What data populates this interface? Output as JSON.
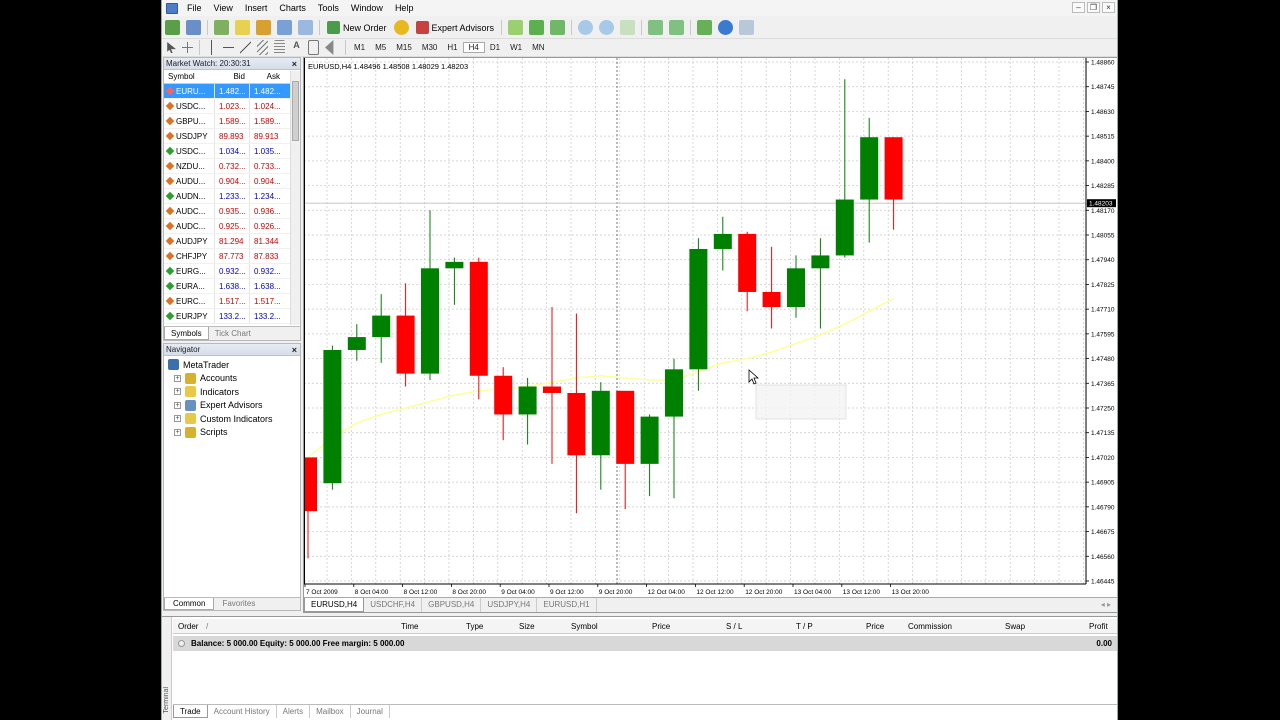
{
  "menu": [
    "File",
    "View",
    "Insert",
    "Charts",
    "Tools",
    "Window",
    "Help"
  ],
  "toolbar": {
    "new_order": "New Order",
    "expert_advisors": "Expert Advisors"
  },
  "periods": [
    "M1",
    "M5",
    "M15",
    "M30",
    "H1",
    "H4",
    "D1",
    "W1",
    "MN"
  ],
  "active_period": "H4",
  "market_watch": {
    "title": "Market Watch: 20:30:31",
    "headers": {
      "symbol": "Symbol",
      "bid": "Bid",
      "ask": "Ask"
    },
    "rows": [
      {
        "symbol": "EURU...",
        "bid": "1.482...",
        "ask": "1.482...",
        "dir": "up",
        "selected": true
      },
      {
        "symbol": "USDC...",
        "bid": "1.023...",
        "ask": "1.024...",
        "dir": "down"
      },
      {
        "symbol": "GBPU...",
        "bid": "1.589...",
        "ask": "1.589...",
        "dir": "down"
      },
      {
        "symbol": "USDJPY",
        "bid": "89.893",
        "ask": "89.913",
        "dir": "down"
      },
      {
        "symbol": "USDC...",
        "bid": "1.034...",
        "ask": "1.035...",
        "dir": "up"
      },
      {
        "symbol": "NZDU...",
        "bid": "0.732...",
        "ask": "0.733...",
        "dir": "down"
      },
      {
        "symbol": "AUDU...",
        "bid": "0.904...",
        "ask": "0.904...",
        "dir": "down"
      },
      {
        "symbol": "AUDN...",
        "bid": "1.233...",
        "ask": "1.234...",
        "dir": "up"
      },
      {
        "symbol": "AUDC...",
        "bid": "0.935...",
        "ask": "0.936...",
        "dir": "down"
      },
      {
        "symbol": "AUDC...",
        "bid": "0.925...",
        "ask": "0.926...",
        "dir": "down"
      },
      {
        "symbol": "AUDJPY",
        "bid": "81.294",
        "ask": "81.344",
        "dir": "down"
      },
      {
        "symbol": "CHFJPY",
        "bid": "87.773",
        "ask": "87.833",
        "dir": "down"
      },
      {
        "symbol": "EURG...",
        "bid": "0.932...",
        "ask": "0.932...",
        "dir": "up"
      },
      {
        "symbol": "EURA...",
        "bid": "1.638...",
        "ask": "1.638...",
        "dir": "up"
      },
      {
        "symbol": "EURC...",
        "bid": "1.517...",
        "ask": "1.517...",
        "dir": "down"
      },
      {
        "symbol": "EURJPY",
        "bid": "133.2...",
        "ask": "133.2...",
        "dir": "up"
      }
    ],
    "tabs": [
      "Symbols",
      "Tick Chart"
    ]
  },
  "navigator": {
    "title": "Navigator",
    "root": "MetaTrader",
    "items": [
      "Accounts",
      "Indicators",
      "Expert Advisors",
      "Custom Indicators",
      "Scripts"
    ],
    "tabs": [
      "Common",
      "Favorites"
    ]
  },
  "chart": {
    "header": "EURUSD,H4  1.48496 1.48508 1.48029 1.48203",
    "current_price": "1.48203",
    "price_labels": [
      "1.48860",
      "1.48745",
      "1.48630",
      "1.48515",
      "1.48400",
      "1.48285",
      "1.48170",
      "1.48055",
      "1.47940",
      "1.47825",
      "1.47710",
      "1.47595",
      "1.47480",
      "1.47365",
      "1.47250",
      "1.47135",
      "1.47020",
      "1.46905",
      "1.46790",
      "1.46675",
      "1.46560",
      "1.46445"
    ],
    "time_labels": [
      "7 Oct 2009",
      "8 Oct 04:00",
      "8 Oct 12:00",
      "8 Oct 20:00",
      "9 Oct 04:00",
      "9 Oct 12:00",
      "9 Oct 20:00",
      "12 Oct 04:00",
      "12 Oct 12:00",
      "12 Oct 20:00",
      "13 Oct 04:00",
      "13 Oct 12:00",
      "13 Oct 20:00"
    ],
    "candles": [
      [
        1.4702,
        1.4677,
        1.469,
        1.4655
      ],
      [
        1.469,
        1.4752,
        1.4754,
        1.4687
      ],
      [
        1.4752,
        1.4758,
        1.4764,
        1.4747
      ],
      [
        1.4758,
        1.4768,
        1.4778,
        1.4746
      ],
      [
        1.4768,
        1.4741,
        1.4783,
        1.4735
      ],
      [
        1.4741,
        1.479,
        1.4817,
        1.4738
      ],
      [
        1.479,
        1.4793,
        1.4795,
        1.4773
      ],
      [
        1.4793,
        1.474,
        1.4795,
        1.4729
      ],
      [
        1.474,
        1.4722,
        1.4744,
        1.471
      ],
      [
        1.4722,
        1.4735,
        1.4739,
        1.4708
      ],
      [
        1.4735,
        1.4732,
        1.4772,
        1.4699
      ],
      [
        1.4732,
        1.4703,
        1.4769,
        1.4676
      ],
      [
        1.4703,
        1.4733,
        1.4737,
        1.4687
      ],
      [
        1.4733,
        1.4699,
        1.4722,
        1.4678
      ],
      [
        1.4699,
        1.4721,
        1.4722,
        1.4684
      ],
      [
        1.4721,
        1.4743,
        1.4748,
        1.4683
      ],
      [
        1.4743,
        1.4799,
        1.4804,
        1.4733
      ],
      [
        1.4799,
        1.4806,
        1.4814,
        1.4789
      ],
      [
        1.4806,
        1.4779,
        1.4807,
        1.477
      ],
      [
        1.4779,
        1.4772,
        1.48,
        1.4762
      ],
      [
        1.4772,
        1.479,
        1.4796,
        1.4767
      ],
      [
        1.479,
        1.4796,
        1.4804,
        1.4762
      ],
      [
        1.4796,
        1.4822,
        1.4878,
        1.4795
      ],
      [
        1.4822,
        1.4851,
        1.486,
        1.4802
      ],
      [
        1.4851,
        1.4822,
        1.4851,
        1.4808
      ]
    ],
    "ma": [
      1.4702,
      1.4711,
      1.4718,
      1.4722,
      1.4725,
      1.4728,
      1.4731,
      1.4733,
      1.4734,
      1.4735,
      1.4737,
      1.4739,
      1.474,
      1.4739,
      1.4738,
      1.4738,
      1.4742,
      1.4746,
      1.4748,
      1.4751,
      1.4755,
      1.4759,
      1.4764,
      1.477,
      1.4776
    ],
    "tabs": [
      "EURUSD,H4",
      "USDCHF,H4",
      "GBPUSD,H4",
      "USDJPY,H4",
      "EURUSD,H1"
    ]
  },
  "terminal": {
    "side_label": "Terminal",
    "columns": [
      "Order",
      "/",
      "Time",
      "Type",
      "Size",
      "Symbol",
      "Price",
      "S / L",
      "T / P",
      "Price",
      "Commission",
      "Swap",
      "Profit"
    ],
    "balance_line": "Balance: 5 000.00  Equity: 5 000.00  Free margin: 5 000.00",
    "balance_profit": "0.00",
    "tabs": [
      "Trade",
      "Account History",
      "Alerts",
      "Mailbox",
      "Journal"
    ]
  },
  "colors": {
    "bull": "#008000",
    "bear": "#ff0000",
    "ma": "#ffff99",
    "grid": "#c8c8c8",
    "selected": "#3399ff"
  }
}
